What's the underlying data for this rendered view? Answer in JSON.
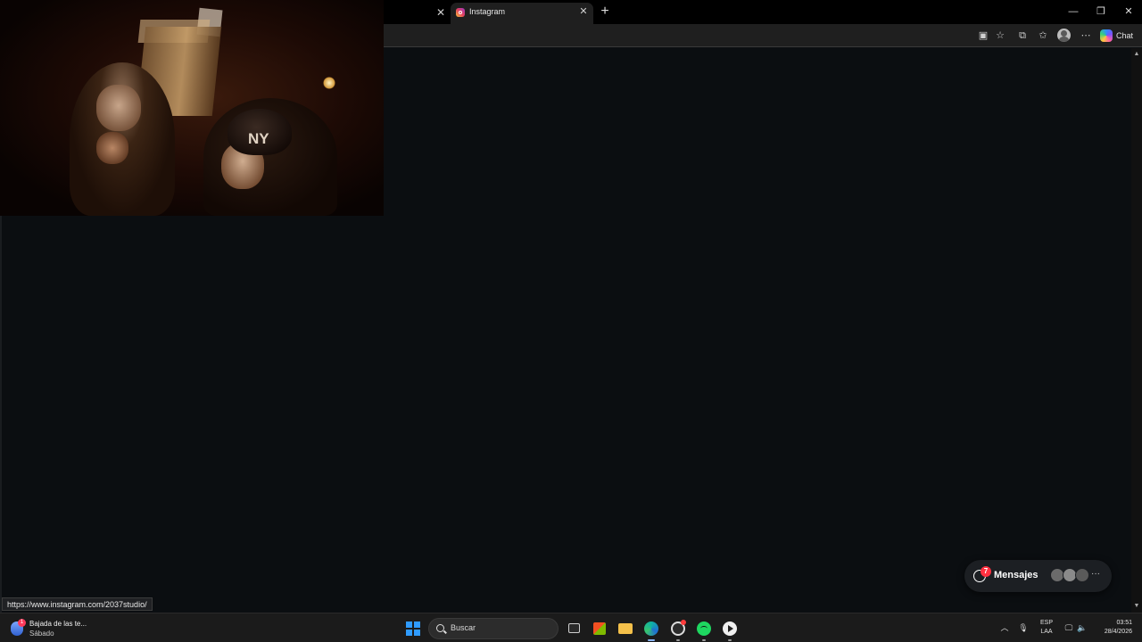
{
  "browser": {
    "active_tab": {
      "title": "Instagram",
      "favicon": "instagram-icon"
    },
    "previous_tab_close": "✕",
    "new_tab": "+",
    "window_controls": {
      "minimize": "—",
      "restore": "❐",
      "close": "✕"
    },
    "toolbar": {
      "icons": [
        "split-screen-icon",
        "favorite-star-icon",
        "extensions-icon",
        "favorites-icon",
        "profile-icon",
        "more-icon"
      ],
      "chat_label": "Chat"
    },
    "status_url": "https://www.instagram.com/2037studio/"
  },
  "instagram": {
    "messages": {
      "label": "Mensajes",
      "unread": "7",
      "avatar_colors": [
        "#6b6b6b",
        "#8a8a8a",
        "#5a5a5a"
      ]
    }
  },
  "webcam_overlay": {
    "cap_logo": "NY"
  },
  "taskbar": {
    "widget": {
      "title": "Bajada de las te...",
      "subtitle": "Sábado",
      "badge": "1"
    },
    "search_placeholder": "Buscar",
    "apps": [
      "task-view",
      "microsoft-store",
      "file-explorer",
      "edge",
      "obs",
      "spotify",
      "media-player"
    ],
    "tray": {
      "language_line1": "ESP",
      "language_line2": "LAA",
      "time": "03:51",
      "date": "28/4/2026"
    }
  },
  "colors": {
    "page_bg": "#0b0e11",
    "notification_red": "#ff3040",
    "accent_blue": "#2f9bff"
  }
}
